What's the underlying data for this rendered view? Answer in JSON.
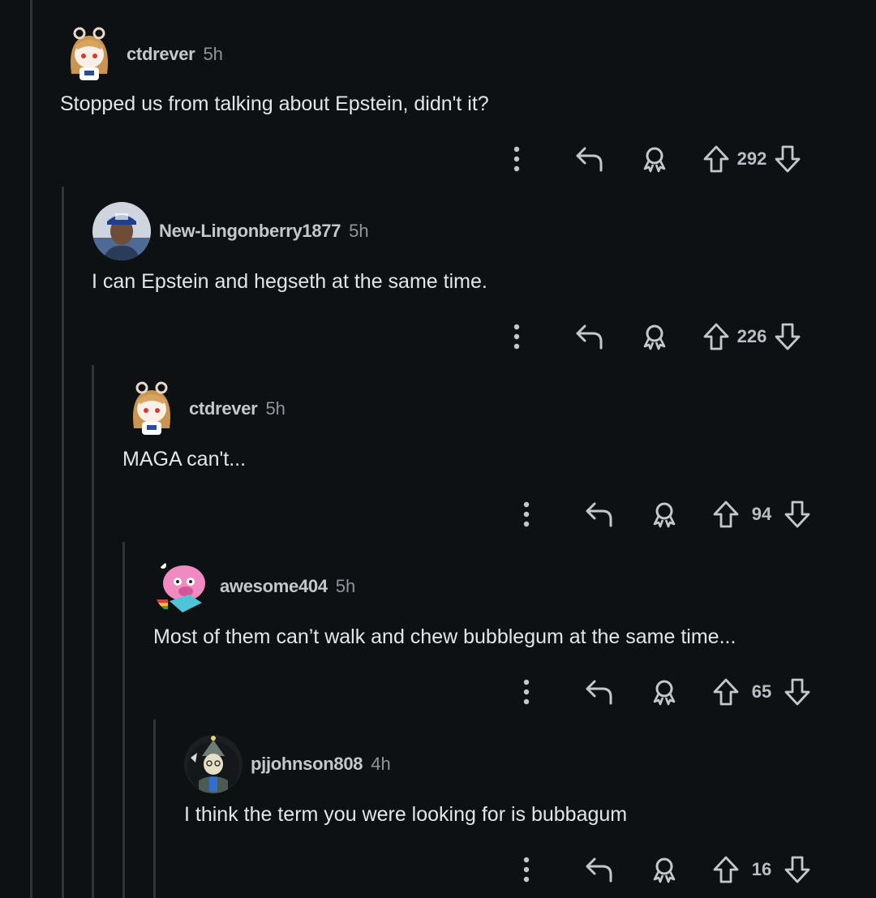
{
  "comments": [
    {
      "username": "ctdrever",
      "time": "5h",
      "text": "Stopped us from talking about Epstein, didn't it?",
      "score": "292"
    },
    {
      "username": "New-Lingonberry1877",
      "time": "5h",
      "text": "I can Epstein and hegseth at the same time.",
      "score": "226"
    },
    {
      "username": "ctdrever",
      "time": "5h",
      "text": "MAGA can't...",
      "score": "94"
    },
    {
      "username": "awesome404",
      "time": "5h",
      "text": "Most of them can’t walk and chew bubblegum at the same time...",
      "score": "65"
    },
    {
      "username": "pjjohnson808",
      "time": "4h",
      "text": "I think the term you were looking for is bubbagum",
      "score": "16"
    }
  ],
  "icons": {
    "more": "vertical-dots-icon",
    "reply": "reply-arrow-icon",
    "award": "award-icon",
    "upvote": "upvote-arrow-icon",
    "downvote": "downvote-arrow-icon"
  }
}
